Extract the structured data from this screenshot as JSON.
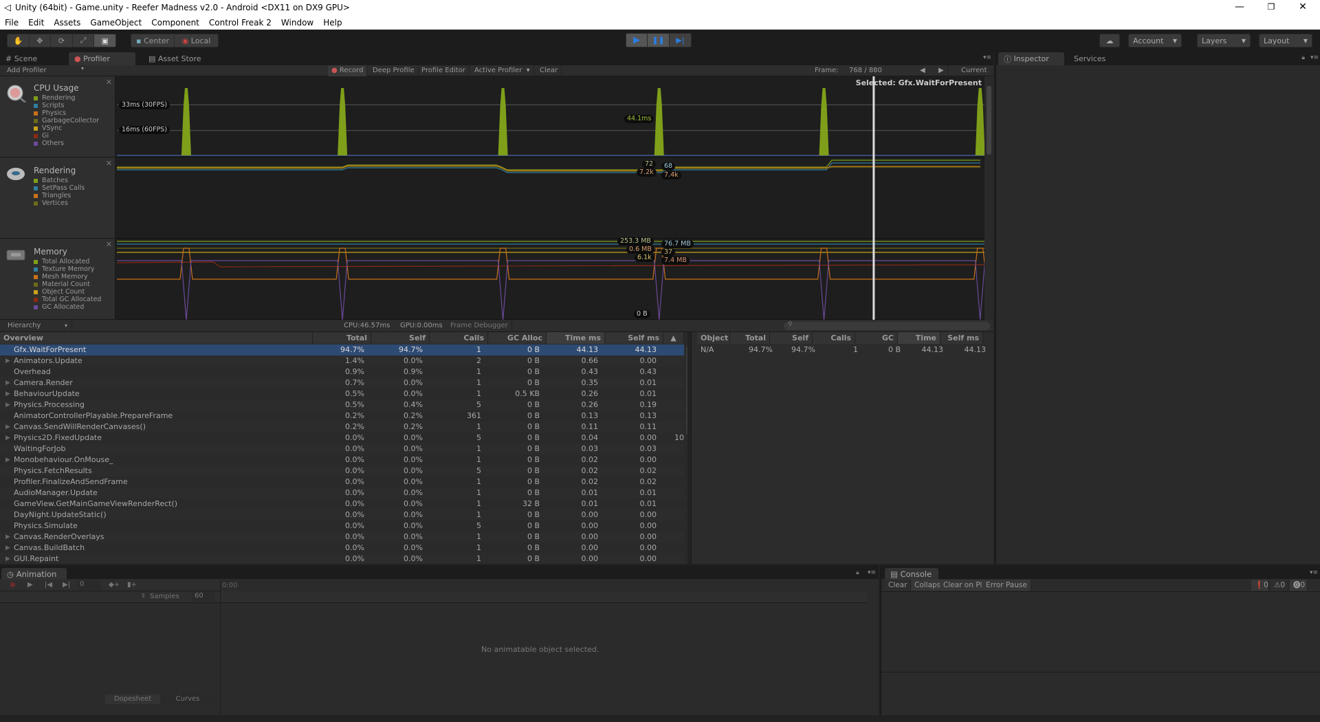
{
  "window": {
    "title": "Unity (64bit) - Game.unity - Reefer Madness v2.0 - Android <DX11 on DX9 GPU>",
    "controls": {
      "minimize": "—",
      "restore": "❐",
      "close": "✕"
    }
  },
  "menu": [
    "File",
    "Edit",
    "Assets",
    "GameObject",
    "Component",
    "Control Freak 2",
    "Window",
    "Help"
  ],
  "toolbar": {
    "tools": [
      "hand-tool",
      "move-tool",
      "rotate-tool",
      "scale-tool",
      "rect-tool"
    ],
    "pivot_label": "Center",
    "space_label": "Local",
    "play": "▶",
    "pause": "❚❚",
    "step": "▶|",
    "account_label": "Account",
    "layers_label": "Layers",
    "layout_label": "Layout"
  },
  "tabs": {
    "scene": "Scene",
    "profiler": "Profiler",
    "asset_store": "Asset Store",
    "inspector": "Inspector",
    "services": "Services"
  },
  "profiler": {
    "add_profiler": "Add Profiler",
    "record": "Record",
    "deep_profile": "Deep Profile",
    "profile_editor": "Profile Editor",
    "active_profiler": "Active Profiler",
    "clear": "Clear",
    "frame_label": "Frame:",
    "frame_value": "768 / 880",
    "current": "Current",
    "selected_label": "Selected: Gfx.WaitForPresent",
    "cpu_time": "CPU:46.57ms",
    "gpu_time": "GPU:0.00ms",
    "frame_debugger": "Frame Debugger",
    "view_mode": "Hierarchy"
  },
  "modules": {
    "cpu": {
      "title": "CPU Usage",
      "legend": [
        {
          "name": "Rendering",
          "color": "#7f9f1a"
        },
        {
          "name": "Scripts",
          "color": "#2f7fa0"
        },
        {
          "name": "Physics",
          "color": "#c8721a"
        },
        {
          "name": "GarbageCollector",
          "color": "#6b6b1a"
        },
        {
          "name": "VSync",
          "color": "#c8a21a"
        },
        {
          "name": "Gi",
          "color": "#8a2a12"
        },
        {
          "name": "Others",
          "color": "#6b4a9a"
        }
      ],
      "guides": [
        "33ms (30FPS)",
        "16ms (60FPS)"
      ],
      "selected_value": "44.1ms"
    },
    "rendering": {
      "title": "Rendering",
      "legend": [
        {
          "name": "Batches",
          "color": "#7f9f1a"
        },
        {
          "name": "SetPass Calls",
          "color": "#2f7fa0"
        },
        {
          "name": "Triangles",
          "color": "#c8721a"
        },
        {
          "name": "Vertices",
          "color": "#6b6b1a"
        }
      ],
      "labels_left": [
        "72",
        "7.2k"
      ],
      "labels_right": [
        "68",
        "7.4k"
      ]
    },
    "memory": {
      "title": "Memory",
      "legend": [
        {
          "name": "Total Allocated",
          "color": "#7f9f1a"
        },
        {
          "name": "Texture Memory",
          "color": "#2f7fa0"
        },
        {
          "name": "Mesh Memory",
          "color": "#c8721a"
        },
        {
          "name": "Material Count",
          "color": "#6b6b1a"
        },
        {
          "name": "Object Count",
          "color": "#c8a21a"
        },
        {
          "name": "Total GC Allocated",
          "color": "#8a2a12"
        },
        {
          "name": "GC Allocated",
          "color": "#6b4a9a"
        }
      ],
      "labels_left": [
        "253.3 MB",
        "0.6 MB",
        "6.1k",
        "0 B"
      ],
      "labels_right": [
        "76.7 MB",
        "37",
        "7.4 MB"
      ]
    }
  },
  "chart_data": {
    "type": "area",
    "title": "CPU Usage",
    "frame_selected": 768,
    "frame_total": 880,
    "guides_ms": [
      33,
      16
    ],
    "spike_positions_fraction": [
      0.08,
      0.26,
      0.445,
      0.625,
      0.815,
      0.995
    ],
    "spike_value_ms": 44.1,
    "baseline_ms": 1
  },
  "table": {
    "columns": [
      "Overview",
      "Total",
      "Self",
      "Calls",
      "GC Alloc",
      "Time ms",
      "Self ms"
    ],
    "rows": [
      {
        "name": "Gfx.WaitForPresent",
        "expand": false,
        "total": "94.7%",
        "self": "94.7%",
        "calls": "1",
        "gc": "0 B",
        "time": "44.13",
        "selfms": "44.13",
        "selected": true
      },
      {
        "name": "Animators.Update",
        "expand": true,
        "total": "1.4%",
        "self": "0.0%",
        "calls": "2",
        "gc": "0 B",
        "time": "0.66",
        "selfms": "0.00"
      },
      {
        "name": "Overhead",
        "expand": false,
        "total": "0.9%",
        "self": "0.9%",
        "calls": "1",
        "gc": "0 B",
        "time": "0.43",
        "selfms": "0.43"
      },
      {
        "name": "Camera.Render",
        "expand": true,
        "total": "0.7%",
        "self": "0.0%",
        "calls": "1",
        "gc": "0 B",
        "time": "0.35",
        "selfms": "0.01"
      },
      {
        "name": "BehaviourUpdate",
        "expand": true,
        "total": "0.5%",
        "self": "0.0%",
        "calls": "1",
        "gc": "0.5 KB",
        "time": "0.26",
        "selfms": "0.01"
      },
      {
        "name": "Physics.Processing",
        "expand": true,
        "total": "0.5%",
        "self": "0.4%",
        "calls": "5",
        "gc": "0 B",
        "time": "0.26",
        "selfms": "0.19"
      },
      {
        "name": "AnimatorControllerPlayable.PrepareFrame",
        "expand": false,
        "total": "0.2%",
        "self": "0.2%",
        "calls": "361",
        "gc": "0 B",
        "time": "0.13",
        "selfms": "0.13"
      },
      {
        "name": "Canvas.SendWillRenderCanvases()",
        "expand": true,
        "total": "0.2%",
        "self": "0.2%",
        "calls": "1",
        "gc": "0 B",
        "time": "0.11",
        "selfms": "0.11"
      },
      {
        "name": "Physics2D.FixedUpdate",
        "expand": true,
        "total": "0.0%",
        "self": "0.0%",
        "calls": "5",
        "gc": "0 B",
        "time": "0.04",
        "selfms": "0.00",
        "extra": "10"
      },
      {
        "name": "WaitingForJob",
        "expand": false,
        "total": "0.0%",
        "self": "0.0%",
        "calls": "1",
        "gc": "0 B",
        "time": "0.03",
        "selfms": "0.03"
      },
      {
        "name": "Monobehaviour.OnMouse_",
        "expand": true,
        "total": "0.0%",
        "self": "0.0%",
        "calls": "1",
        "gc": "0 B",
        "time": "0.02",
        "selfms": "0.00"
      },
      {
        "name": "Physics.FetchResults",
        "expand": false,
        "total": "0.0%",
        "self": "0.0%",
        "calls": "5",
        "gc": "0 B",
        "time": "0.02",
        "selfms": "0.02"
      },
      {
        "name": "Profiler.FinalizeAndSendFrame",
        "expand": false,
        "total": "0.0%",
        "self": "0.0%",
        "calls": "1",
        "gc": "0 B",
        "time": "0.02",
        "selfms": "0.02"
      },
      {
        "name": "AudioManager.Update",
        "expand": false,
        "total": "0.0%",
        "self": "0.0%",
        "calls": "1",
        "gc": "0 B",
        "time": "0.01",
        "selfms": "0.01"
      },
      {
        "name": "GameView.GetMainGameViewRenderRect()",
        "expand": false,
        "total": "0.0%",
        "self": "0.0%",
        "calls": "1",
        "gc": "32 B",
        "time": "0.01",
        "selfms": "0.01"
      },
      {
        "name": "DayNight.UpdateStatic()",
        "expand": false,
        "total": "0.0%",
        "self": "0.0%",
        "calls": "1",
        "gc": "0 B",
        "time": "0.00",
        "selfms": "0.00"
      },
      {
        "name": "Physics.Simulate",
        "expand": false,
        "total": "0.0%",
        "self": "0.0%",
        "calls": "5",
        "gc": "0 B",
        "time": "0.00",
        "selfms": "0.00"
      },
      {
        "name": "Canvas.RenderOverlays",
        "expand": true,
        "total": "0.0%",
        "self": "0.0%",
        "calls": "1",
        "gc": "0 B",
        "time": "0.00",
        "selfms": "0.00"
      },
      {
        "name": "Canvas.BuildBatch",
        "expand": true,
        "total": "0.0%",
        "self": "0.0%",
        "calls": "1",
        "gc": "0 B",
        "time": "0.00",
        "selfms": "0.00"
      },
      {
        "name": "GUI.Repaint",
        "expand": true,
        "total": "0.0%",
        "self": "0.0%",
        "calls": "1",
        "gc": "0 B",
        "time": "0.00",
        "selfms": "0.00"
      }
    ]
  },
  "object_table": {
    "columns": [
      "Object",
      "Total",
      "Self",
      "Calls",
      "GC Alloc",
      "Time ms",
      "Self ms"
    ],
    "rows": [
      {
        "object": "N/A",
        "total": "94.7%",
        "self": "94.7%",
        "calls": "1",
        "gc": "0 B",
        "time": "44.13",
        "selfms": "44.13"
      }
    ]
  },
  "animation": {
    "tab": "Animation",
    "frame_value": "0",
    "time": "0:00",
    "samples_label": "Samples",
    "samples_value": "60",
    "empty_message": "No animatable object selected.",
    "dopesheet": "Dopesheet",
    "curves": "Curves"
  },
  "console": {
    "tab": "Console",
    "clear": "Clear",
    "collapse": "Collapse",
    "clear_on_play": "Clear on Play",
    "error_pause": "Error Pause",
    "info_count": "0",
    "warning_count": "0",
    "error_count": "0"
  }
}
